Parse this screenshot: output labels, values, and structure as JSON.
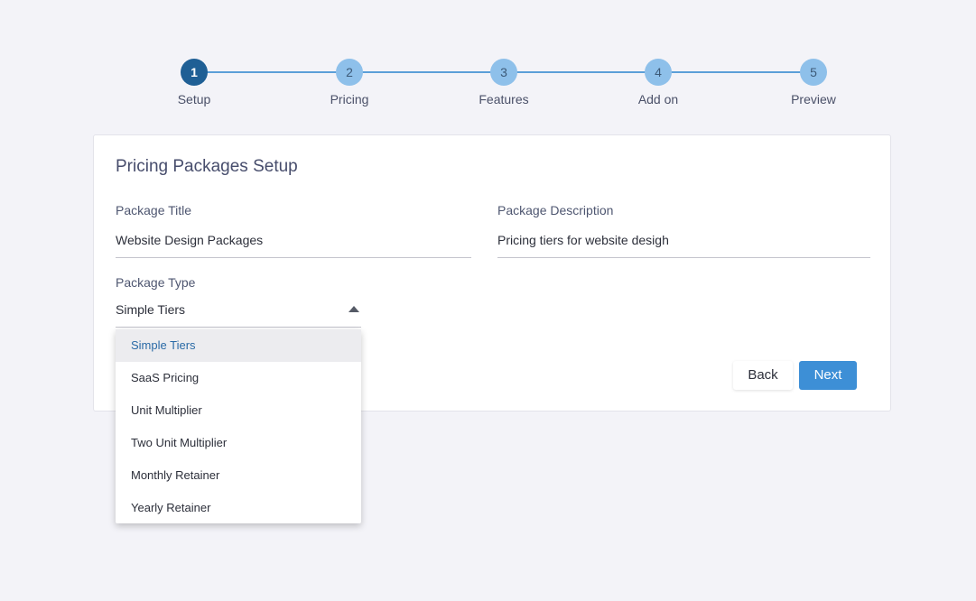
{
  "stepper": {
    "steps": [
      {
        "number": "1",
        "label": "Setup",
        "active": true
      },
      {
        "number": "2",
        "label": "Pricing",
        "active": false
      },
      {
        "number": "3",
        "label": "Features",
        "active": false
      },
      {
        "number": "4",
        "label": "Add on",
        "active": false
      },
      {
        "number": "5",
        "label": "Preview",
        "active": false
      }
    ]
  },
  "card": {
    "title": "Pricing Packages Setup",
    "package_title": {
      "label": "Package Title",
      "value": "Website Design Packages"
    },
    "package_description": {
      "label": "Package Description",
      "value": "Pricing tiers for website desigh"
    },
    "package_type": {
      "label": "Package Type",
      "value": "Simple Tiers"
    },
    "back_label": "Back",
    "next_label": "Next"
  },
  "dropdown": {
    "options": [
      "Simple Tiers",
      "SaaS Pricing",
      "Unit Multiplier",
      "Two Unit Multiplier",
      "Monthly Retainer",
      "Yearly Retainer"
    ],
    "selected": "Simple Tiers"
  },
  "colors": {
    "accent": "#3d8fd6",
    "step_active": "#1f5f95",
    "step_inactive": "#8ec0ea",
    "background": "#f3f3f8"
  }
}
